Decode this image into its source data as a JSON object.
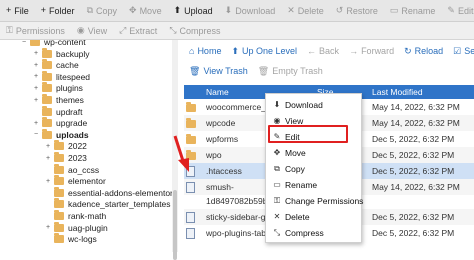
{
  "toolbar": {
    "items": [
      {
        "icon": "plus-icon",
        "label": "File",
        "state": "on",
        "glyph": "+"
      },
      {
        "icon": "plus-icon",
        "label": "Folder",
        "state": "on",
        "glyph": "+"
      },
      {
        "icon": "copy-icon",
        "label": "Copy",
        "state": "off",
        "glyph": "⧉"
      },
      {
        "icon": "move-icon",
        "label": "Move",
        "state": "off",
        "glyph": "✥"
      },
      {
        "icon": "upload-icon",
        "label": "Upload",
        "state": "on",
        "glyph": "⬆"
      },
      {
        "icon": "download-icon",
        "label": "Download",
        "state": "off",
        "glyph": "⬇"
      },
      {
        "icon": "delete-icon",
        "label": "Delete",
        "state": "off",
        "glyph": "✕"
      },
      {
        "icon": "restore-icon",
        "label": "Restore",
        "state": "off",
        "glyph": "↺"
      },
      {
        "icon": "rename-icon",
        "label": "Rename",
        "state": "off",
        "glyph": "▭"
      },
      {
        "icon": "edit-icon",
        "label": "Edit",
        "state": "off",
        "glyph": "✎"
      }
    ]
  },
  "toolbar2": {
    "items": [
      {
        "icon": "key-icon",
        "label": "Permissions",
        "glyph": "⚿"
      },
      {
        "icon": "eye-icon",
        "label": "View",
        "glyph": "◉"
      },
      {
        "icon": "extract-icon",
        "label": "Extract",
        "glyph": "⤢"
      },
      {
        "icon": "compress-icon",
        "label": "Compress",
        "glyph": "⤡"
      }
    ]
  },
  "tree": {
    "items": [
      {
        "label": "wp-content",
        "indent": 0,
        "toggle": "−",
        "bold": false
      },
      {
        "label": "backuply",
        "indent": 1,
        "toggle": "+",
        "bold": false
      },
      {
        "label": "cache",
        "indent": 1,
        "toggle": "+",
        "bold": false
      },
      {
        "label": "litespeed",
        "indent": 1,
        "toggle": "+",
        "bold": false
      },
      {
        "label": "plugins",
        "indent": 1,
        "toggle": "+",
        "bold": false
      },
      {
        "label": "themes",
        "indent": 1,
        "toggle": "+",
        "bold": false
      },
      {
        "label": "updraft",
        "indent": 1,
        "toggle": "",
        "bold": false
      },
      {
        "label": "upgrade",
        "indent": 1,
        "toggle": "+",
        "bold": false
      },
      {
        "label": "uploads",
        "indent": 1,
        "toggle": "−",
        "bold": true
      },
      {
        "label": "2022",
        "indent": 2,
        "toggle": "+",
        "bold": false
      },
      {
        "label": "2023",
        "indent": 2,
        "toggle": "+",
        "bold": false
      },
      {
        "label": "ao_ccss",
        "indent": 2,
        "toggle": "",
        "bold": false
      },
      {
        "label": "elementor",
        "indent": 2,
        "toggle": "+",
        "bold": false
      },
      {
        "label": "essential-addons-elementor",
        "indent": 2,
        "toggle": "",
        "bold": false
      },
      {
        "label": "kadence_starter_templates",
        "indent": 2,
        "toggle": "",
        "bold": false
      },
      {
        "label": "rank-math",
        "indent": 2,
        "toggle": "",
        "bold": false
      },
      {
        "label": "uag-plugin",
        "indent": 2,
        "toggle": "+",
        "bold": false
      },
      {
        "label": "wc-logs",
        "indent": 2,
        "toggle": "",
        "bold": false
      }
    ]
  },
  "nav": {
    "home": "Home",
    "up": "Up One Level",
    "back": "Back",
    "forward": "Forward",
    "reload": "Reload",
    "select_all": "Sele",
    "view_trash": "View Trash",
    "empty_trash": "Empty Trash"
  },
  "table": {
    "headers": {
      "name": "Name",
      "size": "Size",
      "modified": "Last Modified"
    },
    "rows": [
      {
        "name": "woocommerce_up",
        "size": "",
        "modified": "May 14, 2022, 6:32 PM",
        "type": "folder"
      },
      {
        "name": "wpcode",
        "size": "",
        "modified": "May 14, 2022, 6:32 PM",
        "type": "folder"
      },
      {
        "name": "wpforms",
        "size": "",
        "modified": "Dec 5, 2022, 6:32 PM",
        "type": "folder"
      },
      {
        "name": "wpo",
        "size": "",
        "modified": "Dec 5, 2022, 6:32 PM",
        "type": "folder"
      },
      {
        "name": ".htaccess",
        "size": "",
        "modified": "Dec 5, 2022, 6:32 PM",
        "type": "file"
      },
      {
        "name": "smush-",
        "size": "",
        "modified": "May 14, 2022, 6:32 PM",
        "type": "file"
      },
      {
        "name": "1d8497082b59b0c",
        "size": "",
        "modified": "",
        "type": "file-cont"
      },
      {
        "name": "sticky-sidebar-gen",
        "size": "",
        "modified": "Dec 5, 2022, 6:32 PM",
        "type": "file"
      },
      {
        "name": "wpo-plugins-tables",
        "size": "",
        "modified": "Dec 5, 2022, 6:32 PM",
        "type": "file"
      }
    ]
  },
  "context_menu": {
    "items": [
      {
        "icon": "download-icon",
        "label": "Download",
        "glyph": "⬇"
      },
      {
        "icon": "eye-icon",
        "label": "View",
        "glyph": "◉"
      },
      {
        "icon": "pencil-icon",
        "label": "Edit",
        "glyph": "✎"
      },
      {
        "icon": "move-icon",
        "label": "Move",
        "glyph": "✥"
      },
      {
        "icon": "copy-icon",
        "label": "Copy",
        "glyph": "⧉"
      },
      {
        "icon": "rename-icon",
        "label": "Rename",
        "glyph": "▭"
      },
      {
        "icon": "key-icon",
        "label": "Change Permissions",
        "glyph": "⚿"
      },
      {
        "icon": "delete-icon",
        "label": "Delete",
        "glyph": "✕"
      },
      {
        "icon": "compress-icon",
        "label": "Compress",
        "glyph": "⤡"
      }
    ]
  },
  "colors": {
    "accent": "#2f74c8",
    "highlight": "#e02020",
    "folder": "#e9b45c"
  }
}
